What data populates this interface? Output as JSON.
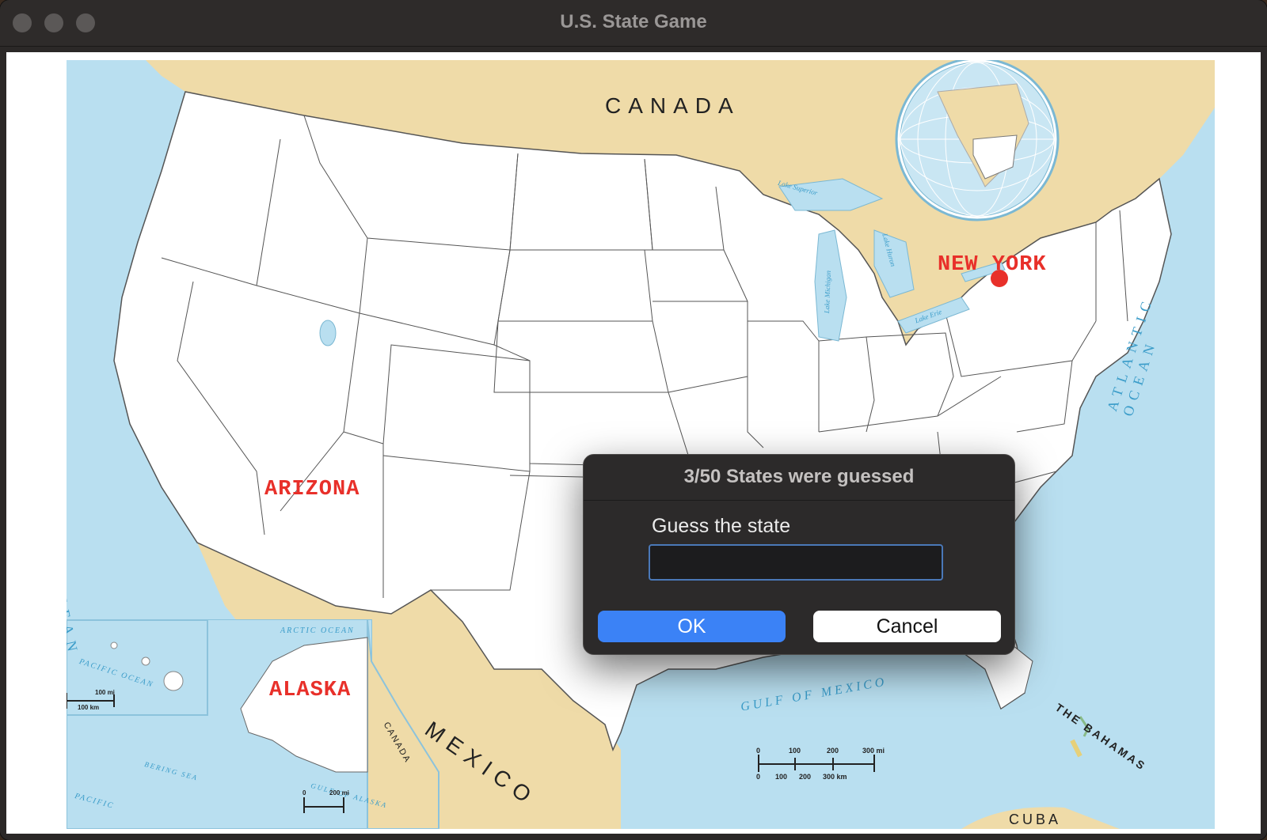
{
  "window": {
    "title": "U.S. State Game"
  },
  "map": {
    "labels": {
      "canada": "CANADA",
      "mexico": "MEXICO",
      "pacific_ocean": "PACIFIC OCEAN",
      "atlantic_ocean": "ATLANTIC OCEAN",
      "gulf": "GULF OF MEXICO",
      "bahamas": "THE BAHAMAS",
      "cuba": "CUBA",
      "arctic_ocean": "ARCTIC OCEAN",
      "bering_sea": "BERING SEA",
      "gulf_alaska": "GULF OF ALASKA",
      "canada_small": "CANADA",
      "pacific_small": "PACIFIC OCEAN",
      "pacific_corner": "PACIFIC",
      "lake_superior": "Lake Superior",
      "lake_michigan": "Lake Michigan",
      "lake_huron": "Lake Huron",
      "lake_erie": "Lake Erie"
    },
    "guessed_states": [
      "NEW YORK",
      "ARIZONA",
      "ALASKA"
    ],
    "scale": {
      "mi": [
        "0",
        "100",
        "200",
        "300 mi"
      ],
      "km": [
        "0",
        "100",
        "200",
        "300 km"
      ],
      "hawaii_mi": "100 mi",
      "hawaii_km": "100 km",
      "alaska_mi": "200 mi",
      "alaska_zero": "0"
    },
    "colors": {
      "water": "#b9dff0",
      "land_foreign": "#efdba8",
      "land_us": "#ffffff",
      "label_red": "#e8302a"
    }
  },
  "dialog": {
    "title": "3/50 States were guessed",
    "prompt": "Guess the state",
    "input_value": "",
    "ok_label": "OK",
    "cancel_label": "Cancel"
  }
}
